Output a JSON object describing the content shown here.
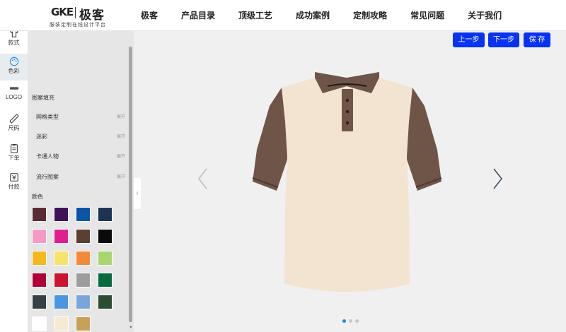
{
  "brand": {
    "mark": "GKE",
    "name": "极客",
    "tagline": "服装定制在线设计平台"
  },
  "nav": [
    {
      "label": "极客"
    },
    {
      "label": "产品目录"
    },
    {
      "label": "顶级工艺"
    },
    {
      "label": "成功案例"
    },
    {
      "label": "定制攻略"
    },
    {
      "label": "常见问题"
    },
    {
      "label": "关于我们"
    }
  ],
  "toolbar": [
    {
      "label": "款式",
      "icon": "shirt-icon"
    },
    {
      "label": "色彩",
      "icon": "palette-icon",
      "active": true
    },
    {
      "label": "LOGO",
      "icon": "logo-icon"
    },
    {
      "label": "尺码",
      "icon": "ruler-icon"
    },
    {
      "label": "下单",
      "icon": "clipboard-icon"
    },
    {
      "label": "付款",
      "icon": "payment-icon"
    }
  ],
  "panel": {
    "pattern_title": "图案填充",
    "options": [
      {
        "label": "网格类型",
        "action": "展开"
      },
      {
        "label": "迷彩",
        "action": "展开"
      },
      {
        "label": "卡通人物",
        "action": "展开"
      },
      {
        "label": "流行图案",
        "action": "展开"
      }
    ],
    "colors_title": "颜色",
    "swatches": [
      "#5a2a35",
      "#3d1457",
      "#0a55a6",
      "#1d3353",
      "#f59ac5",
      "#e01e8f",
      "#5a3f33",
      "#0a0a0a",
      "#f5b820",
      "#f6e36b",
      "#f4893a",
      "#a8d66e",
      "#b0003a",
      "#cc1430",
      "#9c9c9c",
      "#086b3f",
      "#364147",
      "#4a96e0",
      "#7aa5dc",
      "#2d4d33",
      "#ffffff",
      "#f7ead2",
      "#c9a057"
    ]
  },
  "actions": {
    "prev": "上一步",
    "next": "下一步",
    "save": "保 存"
  },
  "product": {
    "body_color": "#f3e4d2",
    "trim_color": "#6f5548"
  },
  "carousel": {
    "count": 3,
    "active_index": 0
  }
}
